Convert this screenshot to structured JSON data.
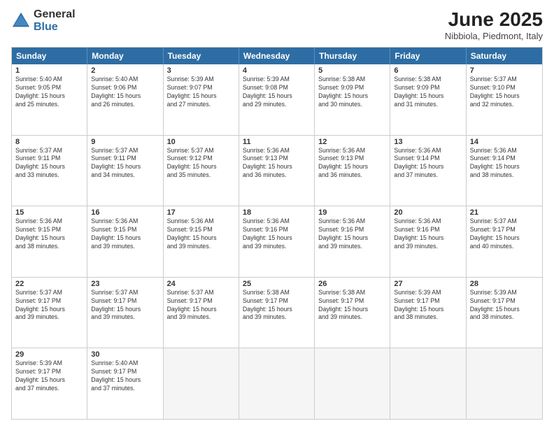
{
  "header": {
    "logo_general": "General",
    "logo_blue": "Blue",
    "month_year": "June 2025",
    "location": "Nibbiola, Piedmont, Italy"
  },
  "calendar": {
    "days": [
      "Sunday",
      "Monday",
      "Tuesday",
      "Wednesday",
      "Thursday",
      "Friday",
      "Saturday"
    ],
    "rows": [
      [
        {
          "day": "",
          "empty": true
        },
        {
          "day": "2",
          "line1": "Sunrise: 5:40 AM",
          "line2": "Sunset: 9:06 PM",
          "line3": "Daylight: 15 hours",
          "line4": "and 26 minutes."
        },
        {
          "day": "3",
          "line1": "Sunrise: 5:39 AM",
          "line2": "Sunset: 9:07 PM",
          "line3": "Daylight: 15 hours",
          "line4": "and 27 minutes."
        },
        {
          "day": "4",
          "line1": "Sunrise: 5:39 AM",
          "line2": "Sunset: 9:08 PM",
          "line3": "Daylight: 15 hours",
          "line4": "and 29 minutes."
        },
        {
          "day": "5",
          "line1": "Sunrise: 5:38 AM",
          "line2": "Sunset: 9:09 PM",
          "line3": "Daylight: 15 hours",
          "line4": "and 30 minutes."
        },
        {
          "day": "6",
          "line1": "Sunrise: 5:38 AM",
          "line2": "Sunset: 9:09 PM",
          "line3": "Daylight: 15 hours",
          "line4": "and 31 minutes."
        },
        {
          "day": "7",
          "line1": "Sunrise: 5:37 AM",
          "line2": "Sunset: 9:10 PM",
          "line3": "Daylight: 15 hours",
          "line4": "and 32 minutes."
        }
      ],
      [
        {
          "day": "8",
          "line1": "Sunrise: 5:37 AM",
          "line2": "Sunset: 9:11 PM",
          "line3": "Daylight: 15 hours",
          "line4": "and 33 minutes."
        },
        {
          "day": "9",
          "line1": "Sunrise: 5:37 AM",
          "line2": "Sunset: 9:11 PM",
          "line3": "Daylight: 15 hours",
          "line4": "and 34 minutes."
        },
        {
          "day": "10",
          "line1": "Sunrise: 5:37 AM",
          "line2": "Sunset: 9:12 PM",
          "line3": "Daylight: 15 hours",
          "line4": "and 35 minutes."
        },
        {
          "day": "11",
          "line1": "Sunrise: 5:36 AM",
          "line2": "Sunset: 9:13 PM",
          "line3": "Daylight: 15 hours",
          "line4": "and 36 minutes."
        },
        {
          "day": "12",
          "line1": "Sunrise: 5:36 AM",
          "line2": "Sunset: 9:13 PM",
          "line3": "Daylight: 15 hours",
          "line4": "and 36 minutes."
        },
        {
          "day": "13",
          "line1": "Sunrise: 5:36 AM",
          "line2": "Sunset: 9:14 PM",
          "line3": "Daylight: 15 hours",
          "line4": "and 37 minutes."
        },
        {
          "day": "14",
          "line1": "Sunrise: 5:36 AM",
          "line2": "Sunset: 9:14 PM",
          "line3": "Daylight: 15 hours",
          "line4": "and 38 minutes."
        }
      ],
      [
        {
          "day": "15",
          "line1": "Sunrise: 5:36 AM",
          "line2": "Sunset: 9:15 PM",
          "line3": "Daylight: 15 hours",
          "line4": "and 38 minutes."
        },
        {
          "day": "16",
          "line1": "Sunrise: 5:36 AM",
          "line2": "Sunset: 9:15 PM",
          "line3": "Daylight: 15 hours",
          "line4": "and 39 minutes."
        },
        {
          "day": "17",
          "line1": "Sunrise: 5:36 AM",
          "line2": "Sunset: 9:15 PM",
          "line3": "Daylight: 15 hours",
          "line4": "and 39 minutes."
        },
        {
          "day": "18",
          "line1": "Sunrise: 5:36 AM",
          "line2": "Sunset: 9:16 PM",
          "line3": "Daylight: 15 hours",
          "line4": "and 39 minutes."
        },
        {
          "day": "19",
          "line1": "Sunrise: 5:36 AM",
          "line2": "Sunset: 9:16 PM",
          "line3": "Daylight: 15 hours",
          "line4": "and 39 minutes."
        },
        {
          "day": "20",
          "line1": "Sunrise: 5:36 AM",
          "line2": "Sunset: 9:16 PM",
          "line3": "Daylight: 15 hours",
          "line4": "and 39 minutes."
        },
        {
          "day": "21",
          "line1": "Sunrise: 5:37 AM",
          "line2": "Sunset: 9:17 PM",
          "line3": "Daylight: 15 hours",
          "line4": "and 40 minutes."
        }
      ],
      [
        {
          "day": "22",
          "line1": "Sunrise: 5:37 AM",
          "line2": "Sunset: 9:17 PM",
          "line3": "Daylight: 15 hours",
          "line4": "and 39 minutes."
        },
        {
          "day": "23",
          "line1": "Sunrise: 5:37 AM",
          "line2": "Sunset: 9:17 PM",
          "line3": "Daylight: 15 hours",
          "line4": "and 39 minutes."
        },
        {
          "day": "24",
          "line1": "Sunrise: 5:37 AM",
          "line2": "Sunset: 9:17 PM",
          "line3": "Daylight: 15 hours",
          "line4": "and 39 minutes."
        },
        {
          "day": "25",
          "line1": "Sunrise: 5:38 AM",
          "line2": "Sunset: 9:17 PM",
          "line3": "Daylight: 15 hours",
          "line4": "and 39 minutes."
        },
        {
          "day": "26",
          "line1": "Sunrise: 5:38 AM",
          "line2": "Sunset: 9:17 PM",
          "line3": "Daylight: 15 hours",
          "line4": "and 39 minutes."
        },
        {
          "day": "27",
          "line1": "Sunrise: 5:39 AM",
          "line2": "Sunset: 9:17 PM",
          "line3": "Daylight: 15 hours",
          "line4": "and 38 minutes."
        },
        {
          "day": "28",
          "line1": "Sunrise: 5:39 AM",
          "line2": "Sunset: 9:17 PM",
          "line3": "Daylight: 15 hours",
          "line4": "and 38 minutes."
        }
      ],
      [
        {
          "day": "29",
          "line1": "Sunrise: 5:39 AM",
          "line2": "Sunset: 9:17 PM",
          "line3": "Daylight: 15 hours",
          "line4": "and 37 minutes."
        },
        {
          "day": "30",
          "line1": "Sunrise: 5:40 AM",
          "line2": "Sunset: 9:17 PM",
          "line3": "Daylight: 15 hours",
          "line4": "and 37 minutes."
        },
        {
          "day": "",
          "empty": true
        },
        {
          "day": "",
          "empty": true
        },
        {
          "day": "",
          "empty": true
        },
        {
          "day": "",
          "empty": true
        },
        {
          "day": "",
          "empty": true
        }
      ]
    ],
    "row0_day1": {
      "day": "1",
      "line1": "Sunrise: 5:40 AM",
      "line2": "Sunset: 9:05 PM",
      "line3": "Daylight: 15 hours",
      "line4": "and 25 minutes."
    }
  }
}
